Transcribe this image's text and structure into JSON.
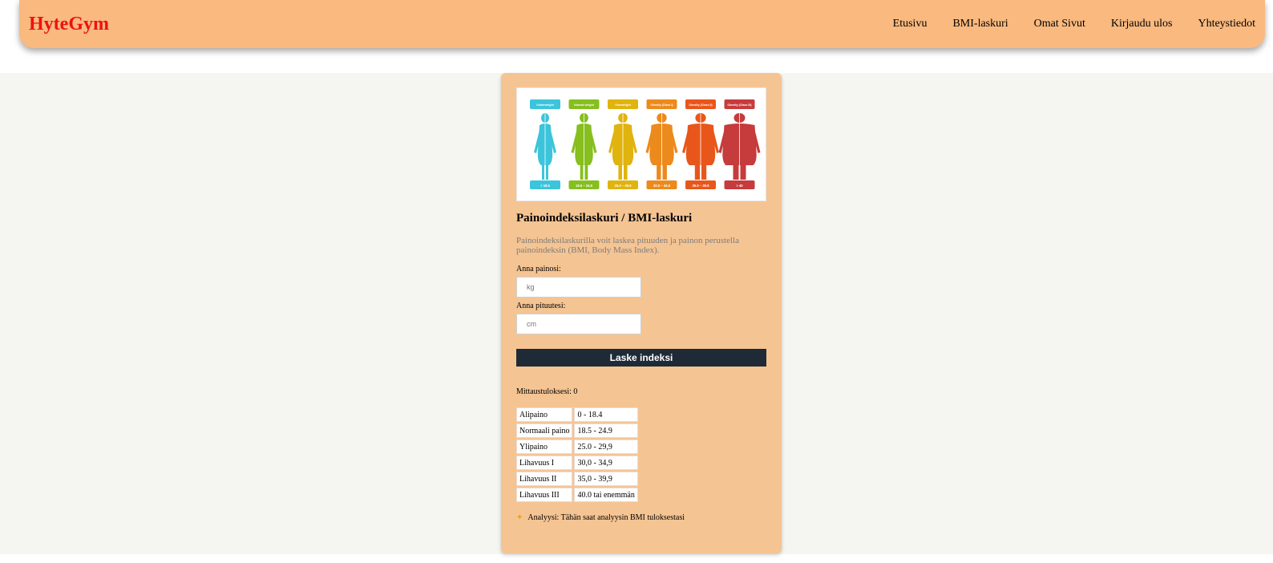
{
  "nav": {
    "brand": "HyteGym",
    "links": [
      "Etusivu",
      "BMI-laskuri",
      "Omat Sivut",
      "Kirjaudu ulos",
      "Yhteystiedot"
    ]
  },
  "bmi_image": {
    "categories": [
      {
        "label": "Underweight",
        "range": "< 18.5",
        "color": "#3cc4da"
      },
      {
        "label": "Normal weight",
        "range": "18.5 – 24.9",
        "color": "#86bf1e"
      },
      {
        "label": "Overweight",
        "range": "25.0 – 29.9",
        "color": "#e0b30e"
      },
      {
        "label": "Obesity (Class I)",
        "range": "30.0 – 34.9",
        "color": "#ec8a1c"
      },
      {
        "label": "Obesity (Class II)",
        "range": "35.0 – 39.9",
        "color": "#e9561b"
      },
      {
        "label": "Obesity (Class III)",
        "range": "> 40",
        "color": "#c63b3b"
      }
    ]
  },
  "calculator": {
    "title": "Painoindeksilaskuri / BMI-laskuri",
    "description": "Painoindeksilaskurilla voit laskea pituuden ja painon perustella painoindeksin (BMI, Body Mass Index).",
    "weight_label": "Anna painosi:",
    "weight_placeholder": "kg",
    "height_label": "Anna pituutesi:",
    "height_placeholder": "cm",
    "button_label": "Laske indeksi",
    "result_label": "Mittaustuloksesi: 0"
  },
  "table": {
    "rows": [
      [
        "Alipaino",
        "0 - 18.4"
      ],
      [
        "Normaali paino",
        "18.5 - 24.9"
      ],
      [
        "Ylipaino",
        "25.0 - 29,9"
      ],
      [
        "Lihavuus I",
        "30,0 - 34,9"
      ],
      [
        "Lihavuus II",
        "35,0 - 39,9"
      ],
      [
        "Lihavuus III",
        "40.0 tai enemmän"
      ]
    ]
  },
  "analysis": {
    "icon": "lightbulb-icon",
    "text": "Analyysi: Tähän saat analyysin BMI tuloksestasi"
  },
  "colors": {
    "navbar": "#f9b97f",
    "brand": "#ee1111",
    "card": "#f5c493",
    "button": "#1f2a37",
    "page_bg": "#f5f5f1"
  }
}
